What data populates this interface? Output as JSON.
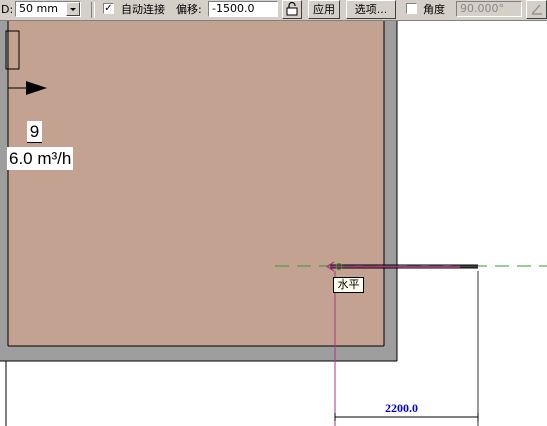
{
  "toolbar": {
    "d_label": "D:",
    "size_value": "50 mm",
    "auto_connect_checked": "✓",
    "auto_connect_label": "自动连接",
    "offset_label": "偏移:",
    "offset_value": "-1500.0",
    "apply_label": "应用",
    "options_label": "选项...",
    "angle_label": "角度",
    "angle_value": "90.000°"
  },
  "canvas": {
    "room_color": "#c4a291",
    "room_number": "9",
    "room_flow": "6.0 m³/h",
    "tooltip": "水平",
    "dimension_value": "2200.0",
    "dimension_color": "#0000cc"
  }
}
